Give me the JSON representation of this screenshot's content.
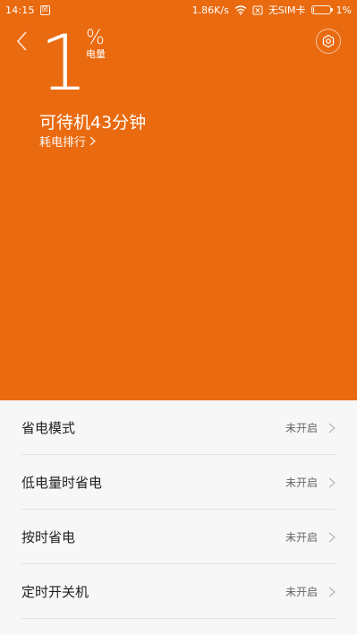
{
  "status_bar": {
    "time": "14:15",
    "notif_glyph": "☒",
    "net_speed": "1.86K/s",
    "sim_status": "无SIM卡",
    "battery_text": "1%",
    "battery_level": 0.01
  },
  "header": {
    "big_level": "1",
    "percent_sign": "%",
    "percent_label": "电量",
    "standby": "可待机43分钟",
    "rank_link": "耗电排行"
  },
  "list": {
    "items": [
      {
        "label": "省电模式",
        "value": "未开启"
      },
      {
        "label": "低电量时省电",
        "value": "未开启"
      },
      {
        "label": "按时省电",
        "value": "未开启"
      },
      {
        "label": "定时开关机",
        "value": "未开启"
      }
    ]
  },
  "colors": {
    "accent": "#ea6a0f",
    "background": "#f7f7f7"
  },
  "icons": {
    "back": "chevron-left-icon",
    "settings": "gear-icon",
    "row": "chevron-right-icon"
  }
}
